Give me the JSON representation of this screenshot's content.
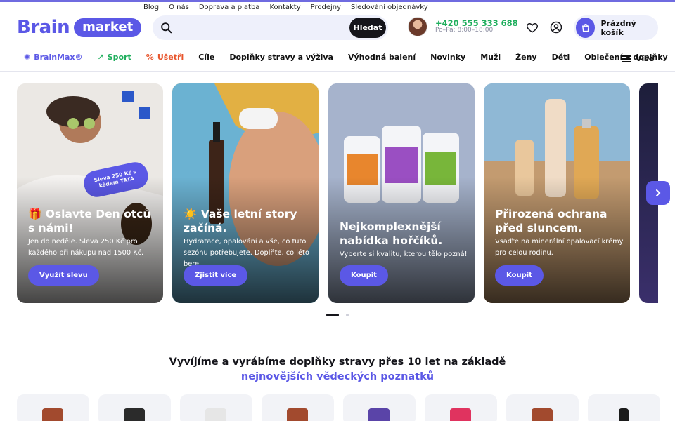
{
  "top_links": [
    "Blog",
    "O nás",
    "Doprava a platba",
    "Kontakty",
    "Prodejny",
    "Sledování objednávky"
  ],
  "logo": {
    "text": "Brain",
    "pill": "market"
  },
  "search": {
    "placeholder": "",
    "button": "Hledat"
  },
  "support": {
    "phone": "+420 555 333 688",
    "hours": "Po–Pá: 8:00–18:00"
  },
  "cart": {
    "label": "Prázdný košík"
  },
  "nav": {
    "items": [
      {
        "label": "BrainMax®",
        "icon": "brainmax-icon"
      },
      {
        "label": "Sport",
        "icon": "trend-arrow-icon"
      },
      {
        "label": "Ušetři",
        "icon": "percent-icon"
      },
      {
        "label": "Cíle"
      },
      {
        "label": "Doplňky stravy a výživa"
      },
      {
        "label": "Výhodná balení"
      },
      {
        "label": "Novinky"
      },
      {
        "label": "Muži"
      },
      {
        "label": "Ženy"
      },
      {
        "label": "Děti"
      },
      {
        "label": "Oblečení a doplňky"
      }
    ],
    "more": "Více"
  },
  "banners": [
    {
      "title": "🎁 Oslavte Den otců s námi!",
      "desc": "Jen do neděle. Sleva 250 Kč pro každého při nákupu nad 1500 Kč.",
      "button": "Využít slevu",
      "sticker": "Sleva 250 Kč s kódem TATA"
    },
    {
      "title": "☀️ Vaše letní story začíná.",
      "desc": "Hydratace, opalování a vše, co tuto sezónu potřebujete. Doplňte, co léto bere.",
      "button": "Zjistit více"
    },
    {
      "title": "Nejkomplexnější nabídka hořčíků.",
      "desc": "Vyberte si kvalitu, kterou tělo pozná!",
      "button": "Koupit"
    },
    {
      "title": "Přirozená ochrana před sluncem.",
      "desc": "Vsaďte na minerální opalovací krémy pro celou rodinu.",
      "button": "Koupit"
    }
  ],
  "headline": {
    "line1": "Vyvíjíme a vyrábíme doplňky stravy přes 10 let na základě",
    "line2": "nejnovějších vědeckých poznatků"
  },
  "colors": {
    "accent": "#5b58e6",
    "green": "#1eae5c",
    "sale": "#e8542b",
    "dark": "#15151b"
  }
}
